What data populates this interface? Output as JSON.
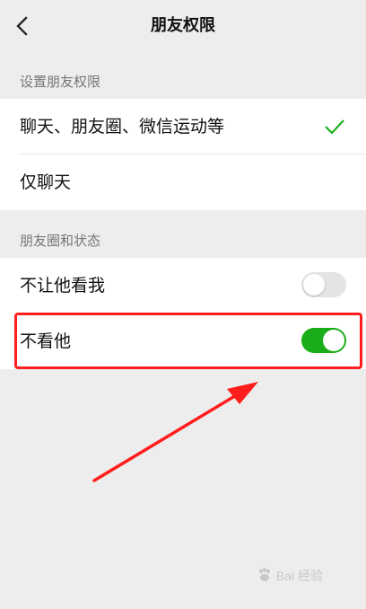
{
  "header": {
    "title": "朋友权限",
    "back_icon": "chevron-left-icon"
  },
  "sections": [
    {
      "label": "设置朋友权限",
      "items": [
        {
          "label": "聊天、朋友圈、微信运动等",
          "selected": true
        },
        {
          "label": "仅聊天",
          "selected": false
        }
      ]
    },
    {
      "label": "朋友圈和状态",
      "items": [
        {
          "label": "不让他看我",
          "enabled": false
        },
        {
          "label": "不看他",
          "enabled": true
        }
      ]
    }
  ],
  "annotation": {
    "highlight_color": "#ff1d1d",
    "arrow_color": "#ff1d1d"
  },
  "watermark": {
    "text": "Bai 经验"
  },
  "colors": {
    "background": "#ededed",
    "surface": "#ffffff",
    "accent": "#1aad19",
    "toggle_off": "#e4e4e4",
    "secondary_text": "#777777"
  }
}
